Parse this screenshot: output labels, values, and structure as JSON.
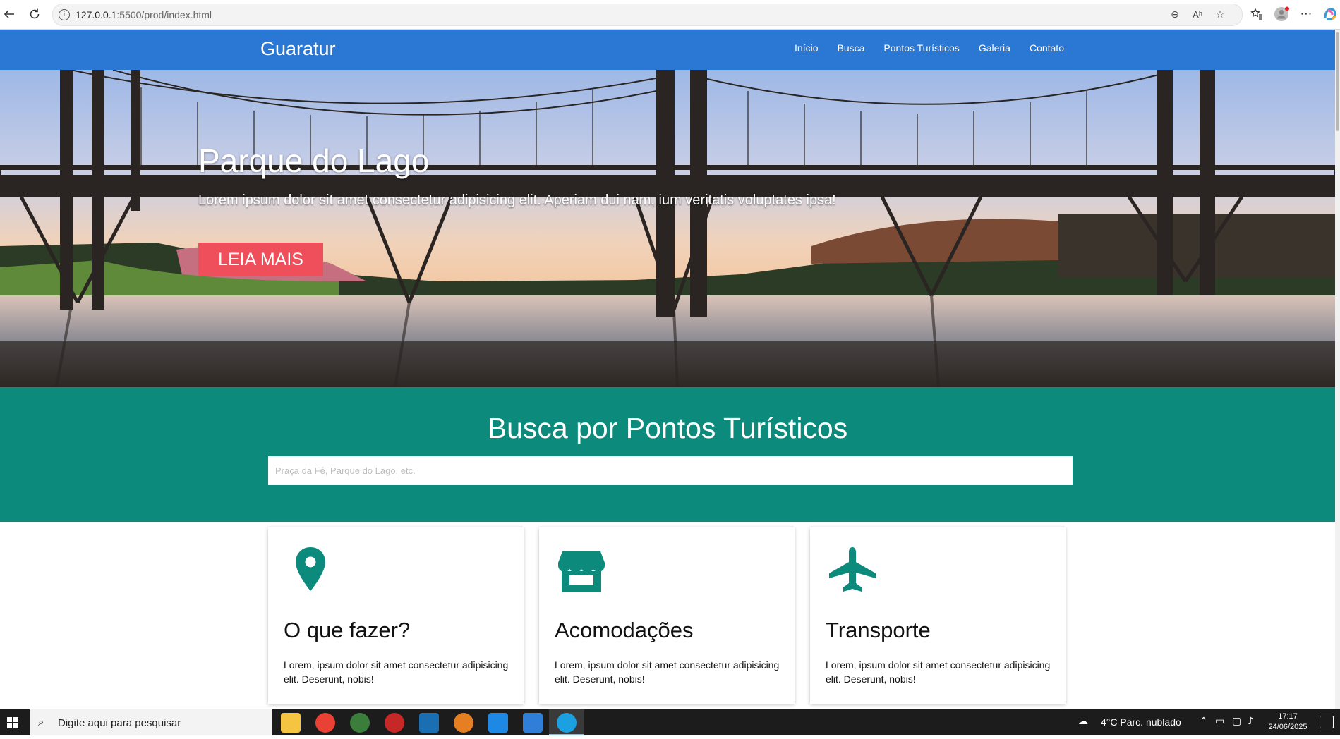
{
  "browser": {
    "url_host": "127.0.0.1",
    "url_rest": ":5500/prod/index.html"
  },
  "site": {
    "brand": "Guaratur",
    "nav": [
      "Início",
      "Busca",
      "Pontos Turísticos",
      "Galeria",
      "Contato"
    ]
  },
  "hero": {
    "title": "Parque do Lago",
    "text": "Lorem ipsum dolor sit amet consectetur adipisicing elit. Aperiam dui nam, ium veritatis voluptates ipsa!",
    "button": "LEIA MAIS"
  },
  "search": {
    "title": "Busca por Pontos Turísticos",
    "placeholder": "Praça da Fé, Parque do Lago, etc."
  },
  "cards": [
    {
      "icon": "map-marker-icon",
      "title": "O que fazer?",
      "text": "Lorem, ipsum dolor sit amet consectetur adipisicing elit. Deserunt, nobis!"
    },
    {
      "icon": "store-icon",
      "title": "Acomodações",
      "text": "Lorem, ipsum dolor sit amet consectetur adipisicing elit. Deserunt, nobis!"
    },
    {
      "icon": "airplane-icon",
      "title": "Transporte",
      "text": "Lorem, ipsum dolor sit amet consectetur adipisicing elit. Deserunt, nobis!"
    }
  ],
  "colors": {
    "navbar": "#2a78d3",
    "search_band": "#0c8b7d",
    "accent_button": "#ee4f5a",
    "card_icon": "#0c8b7d"
  },
  "taskbar": {
    "search_placeholder": "Digite aqui para pesquisar",
    "weather": "4°C  Parc. nublado",
    "time": "17:17",
    "date": "24/06/2025"
  }
}
